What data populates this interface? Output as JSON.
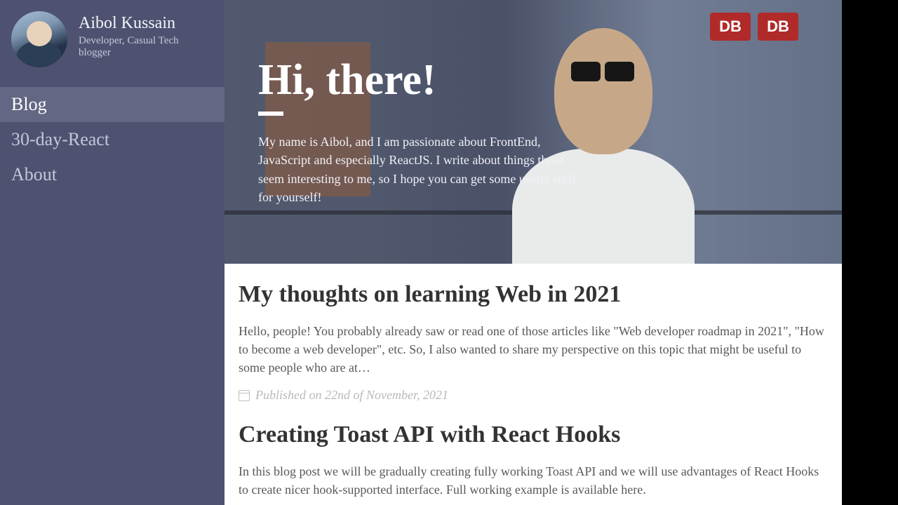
{
  "sidebar": {
    "name": "Aibol Kussain",
    "tagline": "Developer, Casual Tech blogger",
    "nav": [
      {
        "label": "Blog",
        "name": "nav-blog",
        "active": true
      },
      {
        "label": "30-day-React",
        "name": "nav-30-day-react",
        "active": false
      },
      {
        "label": "About",
        "name": "nav-about",
        "active": false
      }
    ]
  },
  "hero": {
    "title": "Hi, there!",
    "body": "My name is Aibol, and I am passionate about FrontEnd, JavaScript and especially ReactJS. I write about things those seem interesting to me, so I hope you can get some useful stuff for yourself!",
    "sign_text": "DB"
  },
  "posts": [
    {
      "title": "My thoughts on learning Web in 2021",
      "excerpt": "Hello, people! You probably already saw or read one of those articles like \"Web developer roadmap in 2021\", \"How to become a web developer\", etc. So, I also wanted to share my perspective on this topic that might be useful to some people who are at…",
      "date": "Published on 22nd of November, 2021"
    },
    {
      "title": "Creating Toast API with React Hooks",
      "excerpt": "In this blog post we will be gradually creating fully working Toast API and we will use advantages of React Hooks to create nicer hook-supported interface. Full working example is available here.",
      "date": ""
    }
  ]
}
